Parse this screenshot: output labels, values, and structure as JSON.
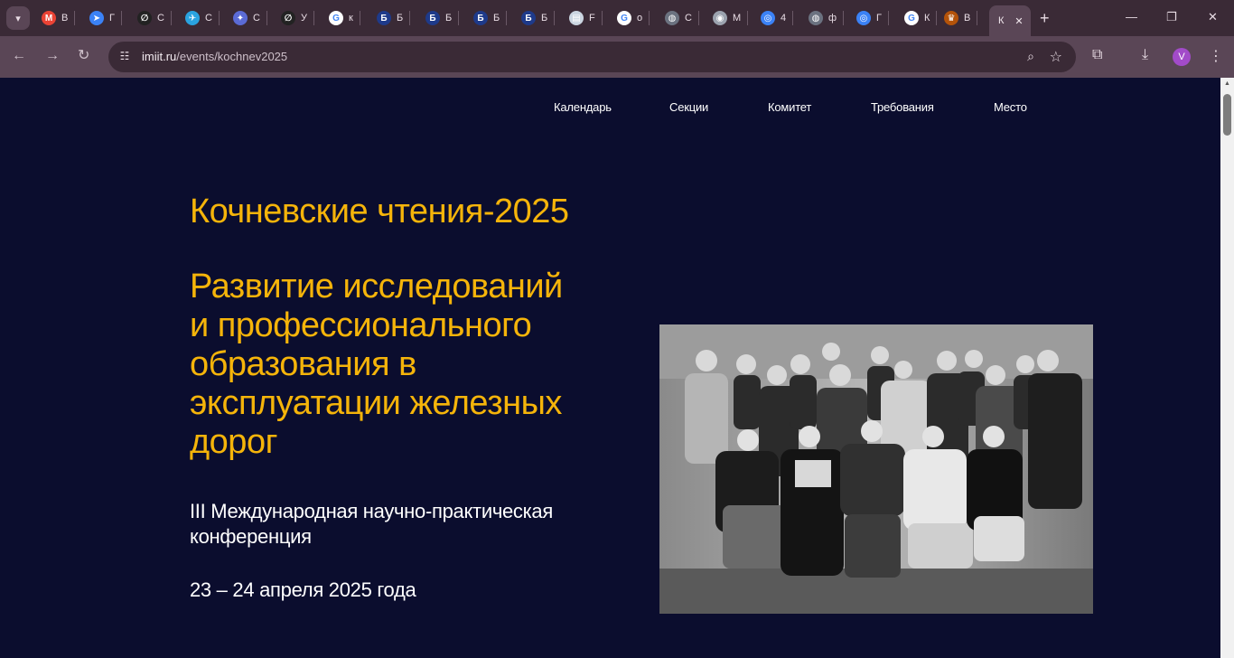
{
  "browser": {
    "tabs": [
      {
        "icon": "gmail-icon",
        "label": "В",
        "color": "#ea4335",
        "glyph": "M"
      },
      {
        "icon": "arrow-app-icon",
        "label": "Г",
        "color": "#3b82f6",
        "glyph": "➤"
      },
      {
        "icon": "loop-icon",
        "label": "С",
        "color": "#222222",
        "glyph": "∅"
      },
      {
        "icon": "telegram-icon",
        "label": "С",
        "color": "#2aa3e0",
        "glyph": "✈"
      },
      {
        "icon": "star-app-icon",
        "label": "С",
        "color": "#5b6bd6",
        "glyph": "✦"
      },
      {
        "icon": "loop-icon",
        "label": "У",
        "color": "#222222",
        "glyph": "∅"
      },
      {
        "icon": "google-icon",
        "label": "к",
        "color": "#ffffff",
        "glyph": "G"
      },
      {
        "icon": "b-letter-icon",
        "label": "Б",
        "color": "#1e3a8a",
        "glyph": "Б"
      },
      {
        "icon": "b-letter-icon",
        "label": "Б",
        "color": "#1e3a8a",
        "glyph": "Б"
      },
      {
        "icon": "b-letter-icon",
        "label": "Б",
        "color": "#1e3a8a",
        "glyph": "Б"
      },
      {
        "icon": "b-letter-icon",
        "label": "Б",
        "color": "#1e3a8a",
        "glyph": "Б"
      },
      {
        "icon": "book-icon",
        "label": "F",
        "color": "#cbd5e1",
        "glyph": "▤"
      },
      {
        "icon": "google-icon",
        "label": "о",
        "color": "#ffffff",
        "glyph": "G"
      },
      {
        "icon": "globe-icon",
        "label": "С",
        "color": "#6b7280",
        "glyph": "◍"
      },
      {
        "icon": "university-icon",
        "label": "М",
        "color": "#9ca3af",
        "glyph": "◉"
      },
      {
        "icon": "circle-logo-icon",
        "label": "4",
        "color": "#3b82f6",
        "glyph": "◎"
      },
      {
        "icon": "globe-icon",
        "label": "ф",
        "color": "#6b7280",
        "glyph": "◍"
      },
      {
        "icon": "circle-logo-icon",
        "label": "Г",
        "color": "#3b82f6",
        "glyph": "◎"
      },
      {
        "icon": "google-icon",
        "label": "К",
        "color": "#ffffff",
        "glyph": "G"
      },
      {
        "icon": "emblem-icon",
        "label": "В",
        "color": "#b45309",
        "glyph": "♛"
      }
    ],
    "active_tab_label": "К",
    "url_host": "imiit.ru",
    "url_path": "/events/kochnev2025",
    "profile_initial": "V"
  },
  "nav": {
    "items": [
      "Календарь",
      "Секции",
      "Комитет",
      "Требования",
      "Место"
    ]
  },
  "hero": {
    "title": "Кочневские чтения-2025",
    "subtitle_lines": [
      "Развитие исследований",
      "и профессионального",
      "образования в",
      "эксплуатации железных",
      "дорог"
    ],
    "conference": "III Международная научно-практическая конференция",
    "dates": "23 – 24 апреля 2025 года"
  },
  "colors": {
    "page_bg": "#0b0d2e",
    "accent": "#f5b40a",
    "text": "#ffffff",
    "chrome_dark": "#3a2a36",
    "chrome_light": "#5a4656"
  }
}
